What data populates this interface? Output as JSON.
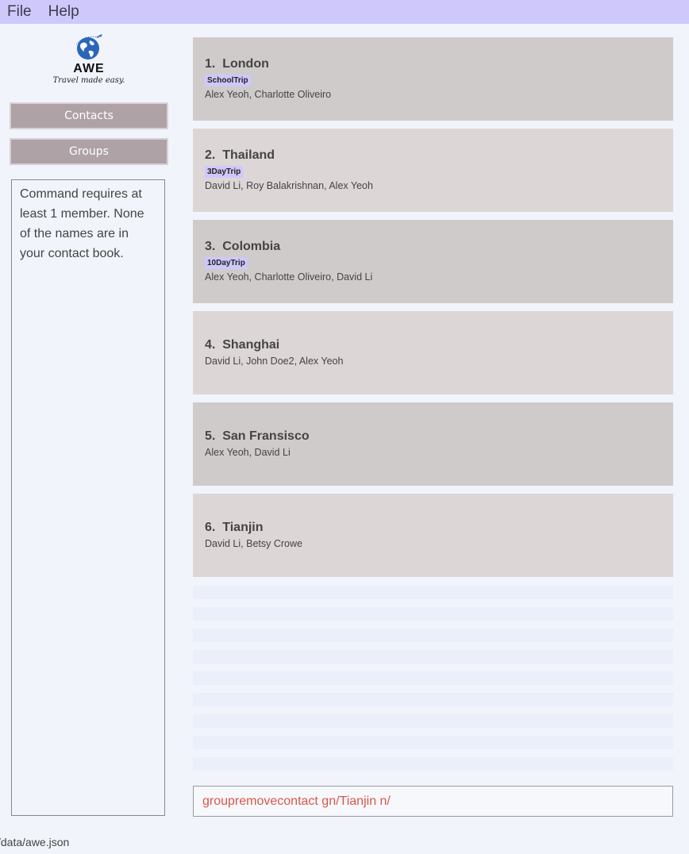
{
  "menu": {
    "file": "File",
    "help": "Help"
  },
  "logo": {
    "name": "AWE",
    "tagline": "Travel made easy."
  },
  "nav": {
    "contacts": "Contacts",
    "groups": "Groups"
  },
  "result_message": "Command requires at least 1 member. None of the names are in your contact book.",
  "groups": [
    {
      "index": "1.",
      "name": "London",
      "tag": "SchoolTrip",
      "members": "Alex Yeoh, Charlotte Oliveiro"
    },
    {
      "index": "2.",
      "name": "Thailand",
      "tag": "3DayTrip",
      "members": "David Li, Roy Balakrishnan, Alex Yeoh"
    },
    {
      "index": "3.",
      "name": "Colombia",
      "tag": "10DayTrip",
      "members": "Alex Yeoh, Charlotte Oliveiro, David Li"
    },
    {
      "index": "4.",
      "name": "Shanghai",
      "tag": "",
      "members": "David Li, John Doe2, Alex Yeoh"
    },
    {
      "index": "5.",
      "name": "San Fransisco",
      "tag": "",
      "members": "Alex Yeoh, David Li"
    },
    {
      "index": "6.",
      "name": "Tianjin",
      "tag": "",
      "members": "David Li, Betsy Crowe"
    }
  ],
  "command_input": "groupremovecontact gn/Tianjin n/",
  "status_path": "/data/awe.json",
  "colors": {
    "menubar": "#cfc8fb",
    "tag": "#cfc8fb",
    "nav_button": "#aea2a7",
    "command_text": "#d8574a"
  }
}
